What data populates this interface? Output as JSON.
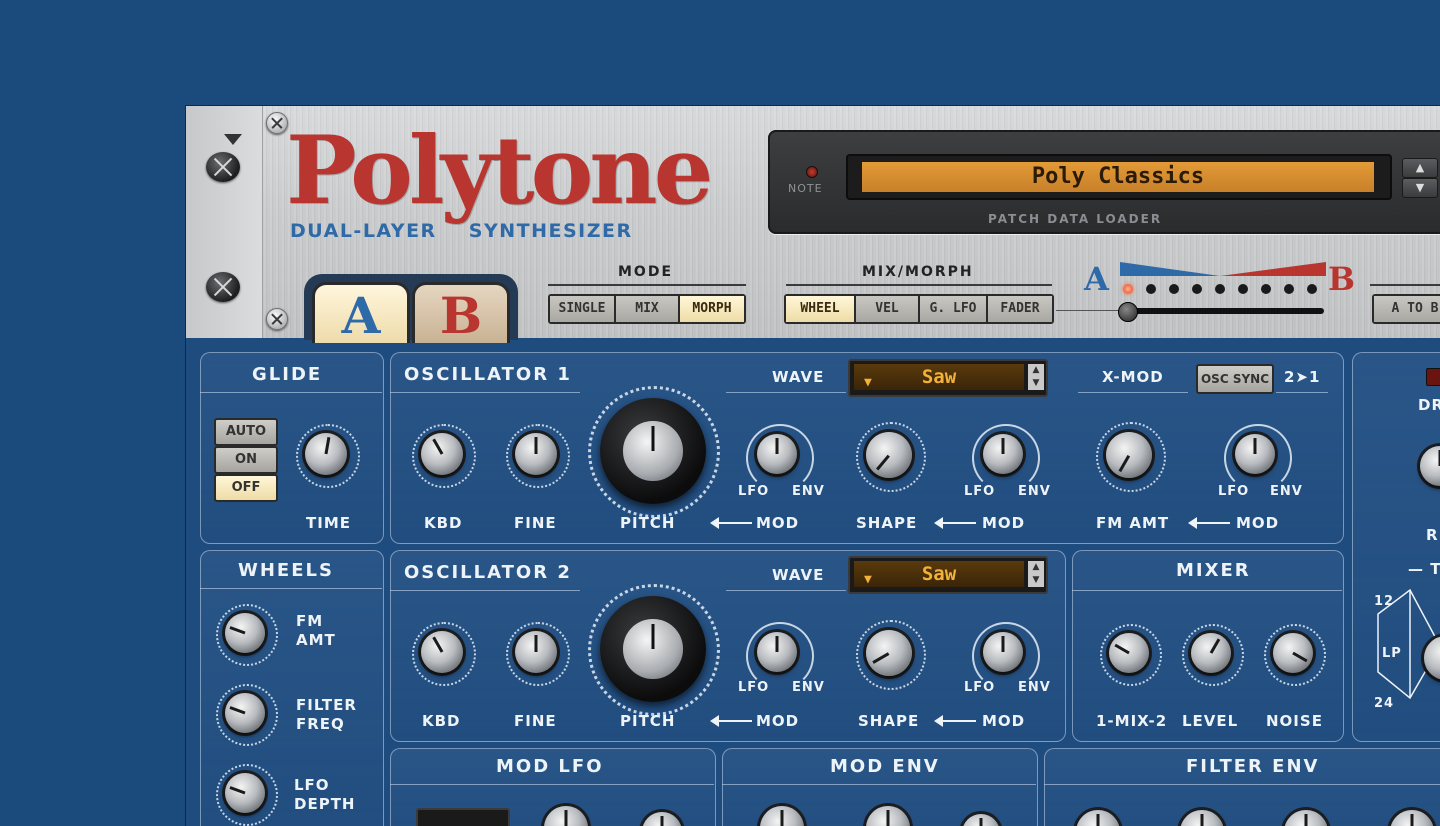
{
  "app": {
    "logo": "Polytone",
    "subtitle": "DUAL-LAYER SYNTHESIZER"
  },
  "patch": {
    "note_label": "NOTE",
    "name": "Poly Classics",
    "caption": "PATCH DATA LOADER",
    "up_glyph": "▲",
    "down_glyph": "▼"
  },
  "layers": {
    "tab_a": "A",
    "tab_b": "B",
    "active": "A"
  },
  "mode": {
    "label": "MODE",
    "options": [
      "SINGLE",
      "MIX",
      "MORPH"
    ],
    "selected": "MORPH"
  },
  "mix_morph": {
    "label": "MIX/MORPH",
    "options": [
      "WHEEL",
      "VEL",
      "G. LFO",
      "FADER"
    ],
    "selected": "WHEEL"
  },
  "morph_slider": {
    "left": "A",
    "right": "B",
    "position": 0
  },
  "a_to_b_button": "A TO B",
  "glide": {
    "title": "GLIDE",
    "buttons": [
      "AUTO",
      "ON",
      "OFF"
    ],
    "selected": "OFF",
    "time_label": "TIME"
  },
  "osc1": {
    "title": "OSCILLATOR 1",
    "wave_label": "WAVE",
    "wave": "Saw",
    "kbd": "KBD",
    "fine": "FINE",
    "pitch": "PITCH",
    "mod": "MOD",
    "lfo": "LFO",
    "env": "ENV",
    "shape": "SHAPE"
  },
  "xmod": {
    "title": "X-MOD",
    "osc_sync": "OSC SYNC",
    "route": "2➤1",
    "fm_amt": "FM AMT",
    "mod": "MOD",
    "lfo": "LFO",
    "env": "ENV"
  },
  "wheels": {
    "title": "WHEELS",
    "items": [
      "FM\nAMT",
      "FILTER\nFREQ",
      "LFO\nDEPTH"
    ]
  },
  "osc2": {
    "title": "OSCILLATOR 2",
    "wave_label": "WAVE",
    "wave": "Saw",
    "kbd": "KBD",
    "fine": "FINE",
    "pitch": "PITCH",
    "mod": "MOD",
    "lfo": "LFO",
    "env": "ENV",
    "shape": "SHAPE"
  },
  "mixer": {
    "title": "MIXER",
    "mix": "1-MIX-2",
    "level": "LEVEL",
    "noise": "NOISE"
  },
  "filter_partial": {
    "label_dr": "DR",
    "label_r": "R",
    "label_t": "— T",
    "n12": "12",
    "lp": "LP",
    "n24": "24"
  },
  "bottom": {
    "mod_lfo": "MOD LFO",
    "mod_env": "MOD ENV",
    "filter_env": "FILTER ENV"
  },
  "colors": {
    "accent_red": "#b8362f",
    "accent_blue": "#2f6aa8",
    "display_amber": "#e39a37",
    "panel_blue": "#1f4c7f"
  }
}
